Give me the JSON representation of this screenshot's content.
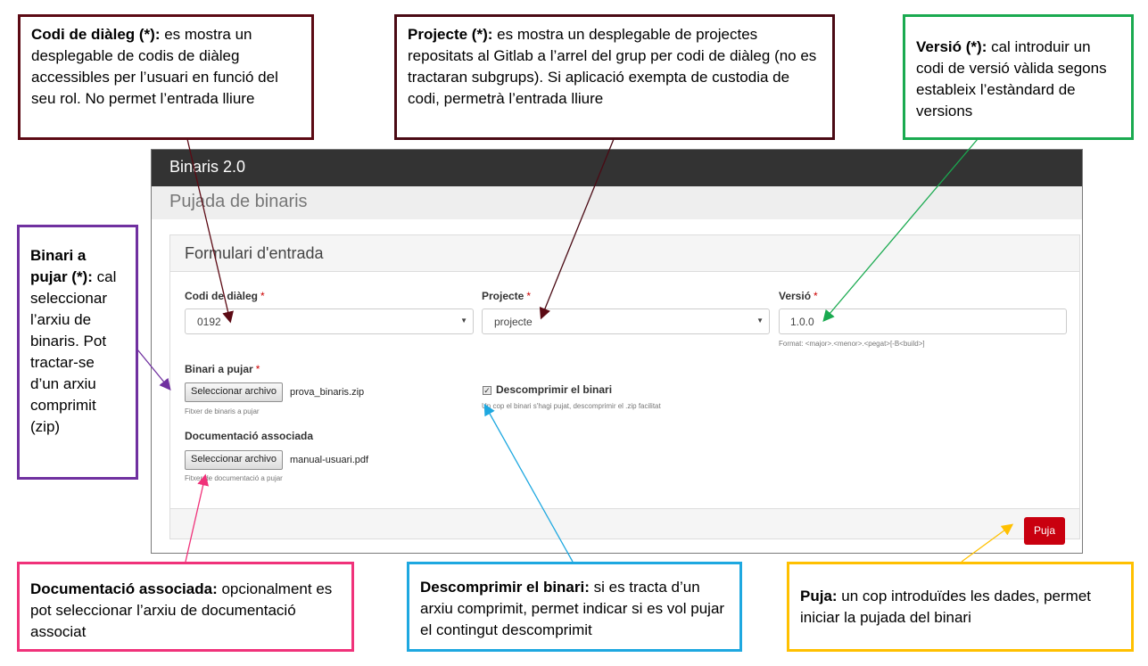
{
  "app": {
    "brand": "Binaris 2.0",
    "page_title": "Pujada de binaris",
    "panel_title": "Formulari d'entrada",
    "required_mark": "*",
    "fields": {
      "codi": {
        "label": "Codi de diàleg",
        "value": "0192"
      },
      "projecte": {
        "label": "Projecte",
        "value": "projecte"
      },
      "versio": {
        "label": "Versió",
        "value": "1.0.0",
        "help": "Format: <major>.<menor>.<pegat>[-B<build>]"
      },
      "binari": {
        "label": "Binari a pujar",
        "button": "Seleccionar archivo",
        "filename": "prova_binaris.zip",
        "help": "Fitxer de binaris a pujar"
      },
      "doc": {
        "label": "Documentació associada",
        "button": "Seleccionar archivo",
        "filename": "manual-usuari.pdf",
        "help": "Fitxer de documentació a pujar"
      },
      "descomprimir": {
        "label": "Descomprimir el binari",
        "checked": true,
        "help": "Un cop el binari s'hagi pujat, descomprimir el .zip facilitat"
      }
    },
    "submit": "Puja"
  },
  "callouts": {
    "codi": {
      "title": "Codi de diàleg (*):",
      "text": " es mostra un desplegable de codis de diàleg accessibles per l’usuari en funció del seu rol. No permet l’entrada lliure",
      "color": "#5c0a14"
    },
    "projecte": {
      "title": "Projecte (*):",
      "text": " es mostra un desplegable de projectes repositats al Gitlab a l’arrel del grup per codi de diàleg (no es tractaran subgrups). Si aplicació exempta de custodia de codi, permetrà l’entrada lliure",
      "color": "#4a0a14"
    },
    "versio": {
      "title": "Versió (*):",
      "text": " cal introduir un codi de versió vàlida segons estableix l’estàndard de versions",
      "color": "#1aaa50"
    },
    "binari": {
      "title": "Binari a pujar (*):",
      "text": " cal seleccionar l’arxiu de binaris. Pot tractar-se d’un arxiu comprimit (zip)",
      "color": "#7030a0"
    },
    "doc": {
      "title": "Documentació associada:",
      "text": " opcionalment es pot seleccionar l’arxiu de documentació associat",
      "color": "#f0327a"
    },
    "descomprimir": {
      "title": "Descomprimir el binari:",
      "text": " si es tracta d’un arxiu comprimit, permet indicar si es vol pujar el contingut descomprimit",
      "color": "#1ea8e0"
    },
    "puja": {
      "title": "Puja:",
      "text": " un cop introduïdes les dades, permet iniciar la pujada del binari",
      "color": "#ffc000"
    }
  }
}
